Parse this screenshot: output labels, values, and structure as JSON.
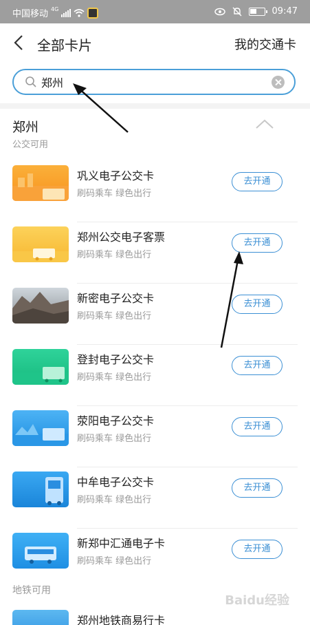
{
  "status_bar": {
    "carrier": "中国移动",
    "network": "4G",
    "time": "09:47"
  },
  "nav": {
    "title": "全部卡片",
    "right_link": "我的交通卡"
  },
  "search": {
    "value": "郑州",
    "placeholder": ""
  },
  "city": {
    "name": "郑州",
    "bus_section": "公交可用",
    "metro_section": "地铁可用"
  },
  "cards": [
    {
      "name": "巩义电子公交卡",
      "desc": "刷码乘车 绿色出行",
      "button": "去开通"
    },
    {
      "name": "郑州公交电子客票",
      "desc": "刷码乘车 绿色出行",
      "button": "去开通"
    },
    {
      "name": "新密电子公交卡",
      "desc": "刷码乘车 绿色出行",
      "button": "去开通"
    },
    {
      "name": "登封电子公交卡",
      "desc": "刷码乘车 绿色出行",
      "button": "去开通"
    },
    {
      "name": "荥阳电子公交卡",
      "desc": "刷码乘车 绿色出行",
      "button": "去开通"
    },
    {
      "name": "中牟电子公交卡",
      "desc": "刷码乘车 绿色出行",
      "button": "去开通"
    },
    {
      "name": "新郑中汇通电子卡",
      "desc": "刷码乘车 绿色出行",
      "button": "去开通"
    }
  ],
  "metro_cards": [
    {
      "name": "郑州地铁商易行卡"
    }
  ],
  "watermark": "Baidu经验",
  "colors": {
    "accent": "#3b8fd4",
    "status_bar": "#9e9e9e"
  }
}
